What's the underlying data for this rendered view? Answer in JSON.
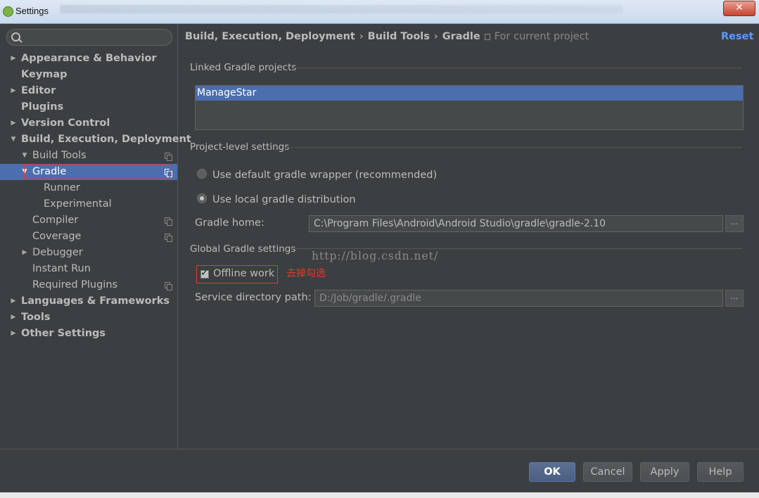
{
  "window": {
    "title": "Settings",
    "close_label": "✕",
    "background_color": "#3c3f41",
    "accent_color": "#4b6eaf",
    "link_color": "#589df6",
    "annotation_color": "#e03a2f"
  },
  "sidebar": {
    "search_placeholder": "",
    "items": [
      {
        "label": "Appearance & Behavior",
        "bold": true,
        "expandable": true,
        "expanded": false
      },
      {
        "label": "Keymap",
        "bold": true,
        "expandable": false
      },
      {
        "label": "Editor",
        "bold": true,
        "expandable": true,
        "expanded": false
      },
      {
        "label": "Plugins",
        "bold": true,
        "expandable": false
      },
      {
        "label": "Version Control",
        "bold": true,
        "expandable": true,
        "expanded": false
      },
      {
        "label": "Build, Execution, Deployment",
        "bold": true,
        "expandable": true,
        "expanded": true
      },
      {
        "label": "Build Tools",
        "bold": false,
        "expandable": true,
        "expanded": true,
        "project_icon": true
      },
      {
        "label": "Gradle",
        "bold": false,
        "expandable": true,
        "expanded": true,
        "selected": true,
        "project_icon": true
      },
      {
        "label": "Runner",
        "bold": false,
        "expandable": false
      },
      {
        "label": "Experimental",
        "bold": false,
        "expandable": false
      },
      {
        "label": "Compiler",
        "bold": false,
        "expandable": false,
        "project_icon": true
      },
      {
        "label": "Coverage",
        "bold": false,
        "expandable": false,
        "project_icon": true
      },
      {
        "label": "Debugger",
        "bold": false,
        "expandable": true,
        "expanded": false
      },
      {
        "label": "Instant Run",
        "bold": false,
        "expandable": false
      },
      {
        "label": "Required Plugins",
        "bold": false,
        "expandable": false,
        "project_icon": true
      },
      {
        "label": "Languages & Frameworks",
        "bold": true,
        "expandable": true,
        "expanded": false
      },
      {
        "label": "Tools",
        "bold": true,
        "expandable": true,
        "expanded": false
      },
      {
        "label": "Other Settings",
        "bold": true,
        "expandable": true,
        "expanded": false
      }
    ]
  },
  "breadcrumb": {
    "part1": "Build, Execution, Deployment",
    "part2": "Build Tools",
    "part3": "Gradle",
    "separator": "›",
    "project_note": "For current project",
    "reset_label": "Reset"
  },
  "linked_projects": {
    "title": "Linked Gradle projects",
    "items": [
      "ManageStar"
    ]
  },
  "project_level": {
    "title": "Project-level settings",
    "option_default": "Use default gradle wrapper (recommended)",
    "option_local": "Use local gradle distribution",
    "selected": "local",
    "gradle_home_label": "Gradle home:",
    "gradle_home_value": "C:\\Program Files\\Android\\Android Studio\\gradle\\gradle-2.10",
    "browse_label": "..."
  },
  "global": {
    "title": "Global Gradle settings",
    "offline_label": "Offline work",
    "offline_checked": true,
    "service_label": "Service directory path:",
    "service_value": "D:/Job/gradle/.gradle",
    "browse_label": "..."
  },
  "annotation": {
    "text": "去掉勾选",
    "watermark": "http://blog.csdn.net/"
  },
  "buttons": {
    "ok": "OK",
    "cancel": "Cancel",
    "apply": "Apply",
    "help": "Help"
  }
}
